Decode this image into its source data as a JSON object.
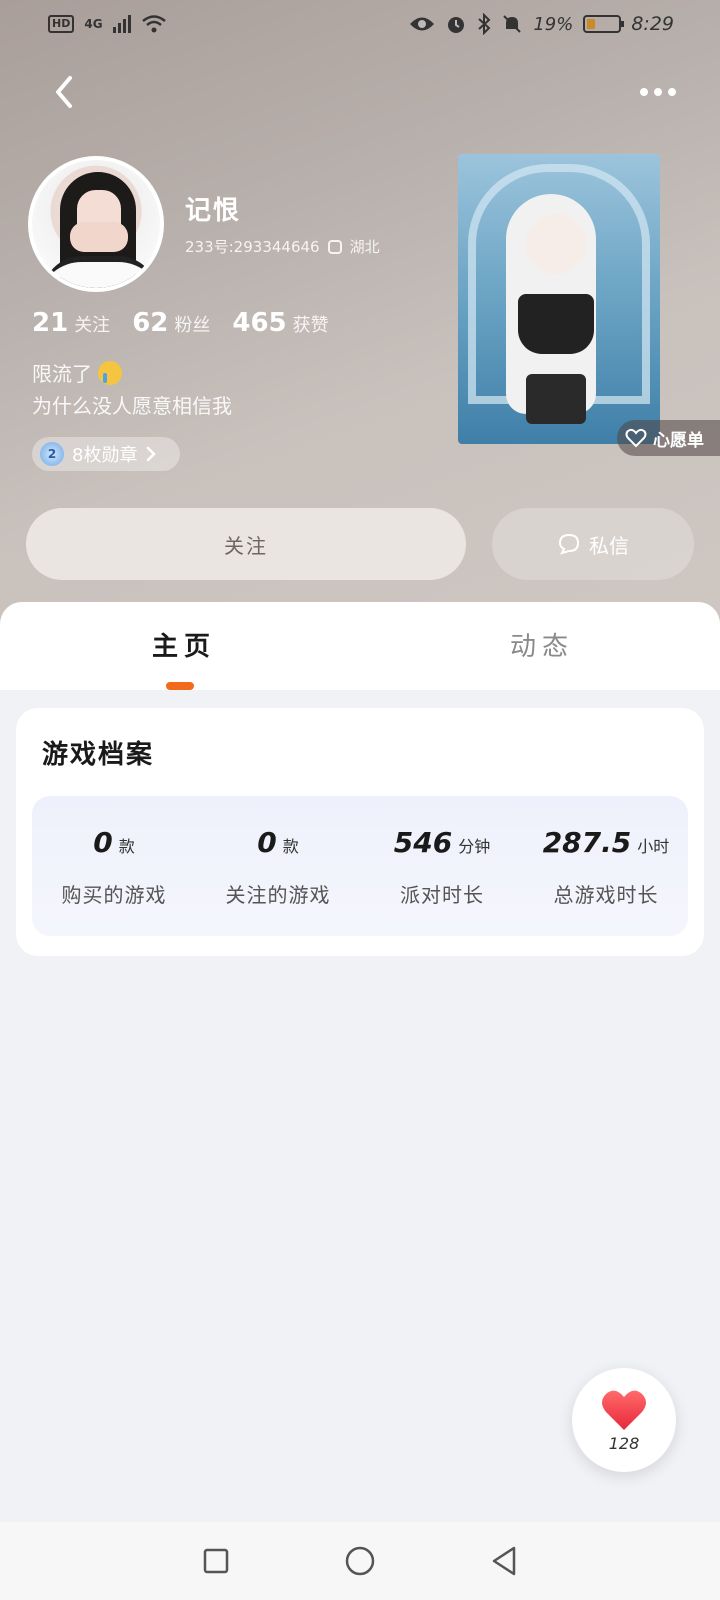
{
  "status_bar": {
    "hd": "HD",
    "network": "4G",
    "battery_pct": "19%",
    "time": "8:29"
  },
  "profile": {
    "username": "记恨",
    "uid": "233号:293344646",
    "location": "湖北",
    "stats": [
      {
        "value": "21",
        "label": "关注"
      },
      {
        "value": "62",
        "label": "粉丝"
      },
      {
        "value": "465",
        "label": "获赞"
      }
    ],
    "bio_line1": "限流了",
    "bio_line2": "为什么没人愿意相信我",
    "badge_level": "2",
    "badge_text": "8枚勋章",
    "wishlist_label": "心愿单"
  },
  "actions": {
    "follow_label": "关注",
    "dm_label": "私信"
  },
  "tabs": [
    {
      "label": "主页",
      "active": true
    },
    {
      "label": "动态",
      "active": false
    }
  ],
  "game_profile": {
    "title": "游戏档案",
    "items": [
      {
        "value": "0",
        "unit": "款",
        "label": "购买的游戏"
      },
      {
        "value": "0",
        "unit": "款",
        "label": "关注的游戏"
      },
      {
        "value": "546",
        "unit": "分钟",
        "label": "派对时长"
      },
      {
        "value": "287.5",
        "unit": "小时",
        "label": "总游戏时长"
      }
    ]
  },
  "like": {
    "count": "128"
  },
  "colors": {
    "accent": "#f26a1b",
    "like": "#f0484f"
  }
}
